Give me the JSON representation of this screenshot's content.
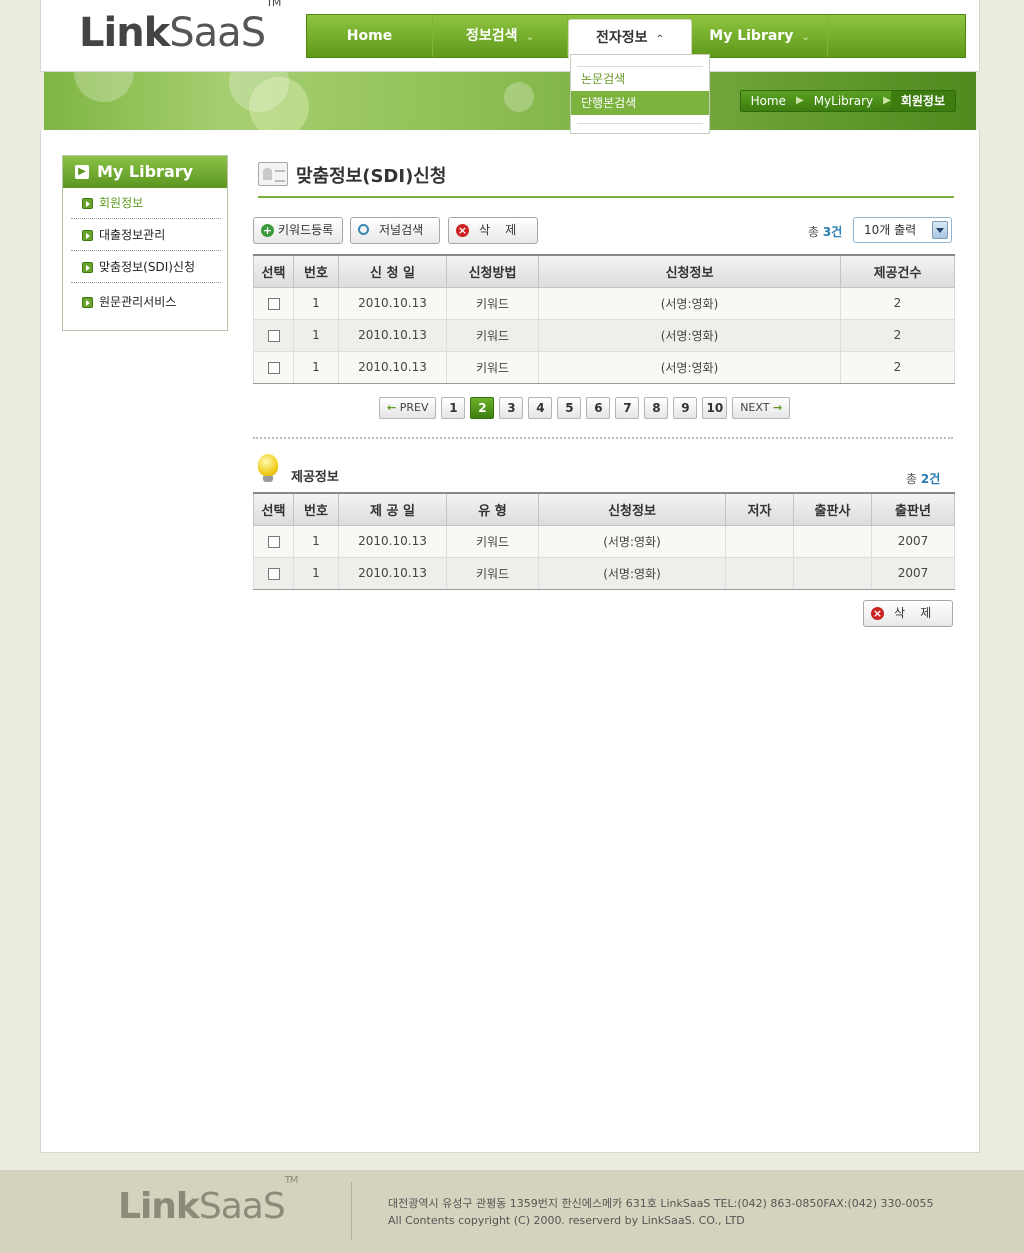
{
  "header": {
    "logo_main": "Link",
    "logo_sub": "SaaS",
    "logo_tm": "TM"
  },
  "gnb": [
    {
      "label": "Home"
    },
    {
      "label": "정보검색"
    },
    {
      "label": "전자정보"
    },
    {
      "label": "My Library"
    }
  ],
  "dropdown": [
    "논문검색",
    "단행본검색"
  ],
  "breadcrumb": {
    "home": "Home",
    "mid": "MyLibrary",
    "current": "회원정보"
  },
  "lnb": {
    "title": "My Library",
    "items": [
      "회원정보",
      "대출정보관리",
      "맞춤정보(SDI)신청",
      "원문관리서비스"
    ]
  },
  "page_title": "맞춤정보(SDI)신청",
  "toolbar": {
    "keyword_btn": "키워드등록",
    "journal_btn": "저널검색",
    "delete_btn": "삭    제",
    "total_prefix": "총",
    "total_count": "3건",
    "page_size": "10개 출력"
  },
  "table1": {
    "headers": [
      "선택",
      "번호",
      "신 청 일",
      "신청방법",
      "신청정보",
      "제공건수"
    ],
    "rows": [
      {
        "no": "1",
        "date": "2010.10.13",
        "method": "키워드",
        "info": "(서명:영화)",
        "count": "2"
      },
      {
        "no": "1",
        "date": "2010.10.13",
        "method": "키워드",
        "info": "(서명:영화)",
        "count": "2"
      },
      {
        "no": "1",
        "date": "2010.10.13",
        "method": "키워드",
        "info": "(서명:영화)",
        "count": "2"
      }
    ]
  },
  "pager": {
    "prev": "PREV",
    "next": "NEXT",
    "pages": [
      "1",
      "2",
      "3",
      "4",
      "5",
      "6",
      "7",
      "8",
      "9",
      "10"
    ],
    "current": "2"
  },
  "section2": {
    "title": "제공정보",
    "total_prefix": "총",
    "total_count": "2건"
  },
  "table2": {
    "headers": [
      "선택",
      "번호",
      "제 공 일",
      "유 형",
      "신청정보",
      "저자",
      "출판사",
      "출판년"
    ],
    "rows": [
      {
        "no": "1",
        "date": "2010.10.13",
        "type": "키워드",
        "info": "(서명:영화)",
        "author": "",
        "publisher": "",
        "year": "2007"
      },
      {
        "no": "1",
        "date": "2010.10.13",
        "type": "키워드",
        "info": "(서명:영화)",
        "author": "",
        "publisher": "",
        "year": "2007"
      }
    ]
  },
  "delete_bottom": "삭    제",
  "footer": {
    "logo_main": "Link",
    "logo_sub": "SaaS",
    "logo_tm": "TM",
    "address": "대전광역시 유성구 관평동 1359번지 한신에스메카 631호 LinkSaaS TEL:(042) 863-0850FAX:(042) 330-0055",
    "copyright": "All Contents copyright (C) 2000. reserverd by LinkSaaS. CO., LTD"
  },
  "colors": {
    "brand_green": "#6aa22c",
    "accent_blue": "#2a7db3"
  }
}
